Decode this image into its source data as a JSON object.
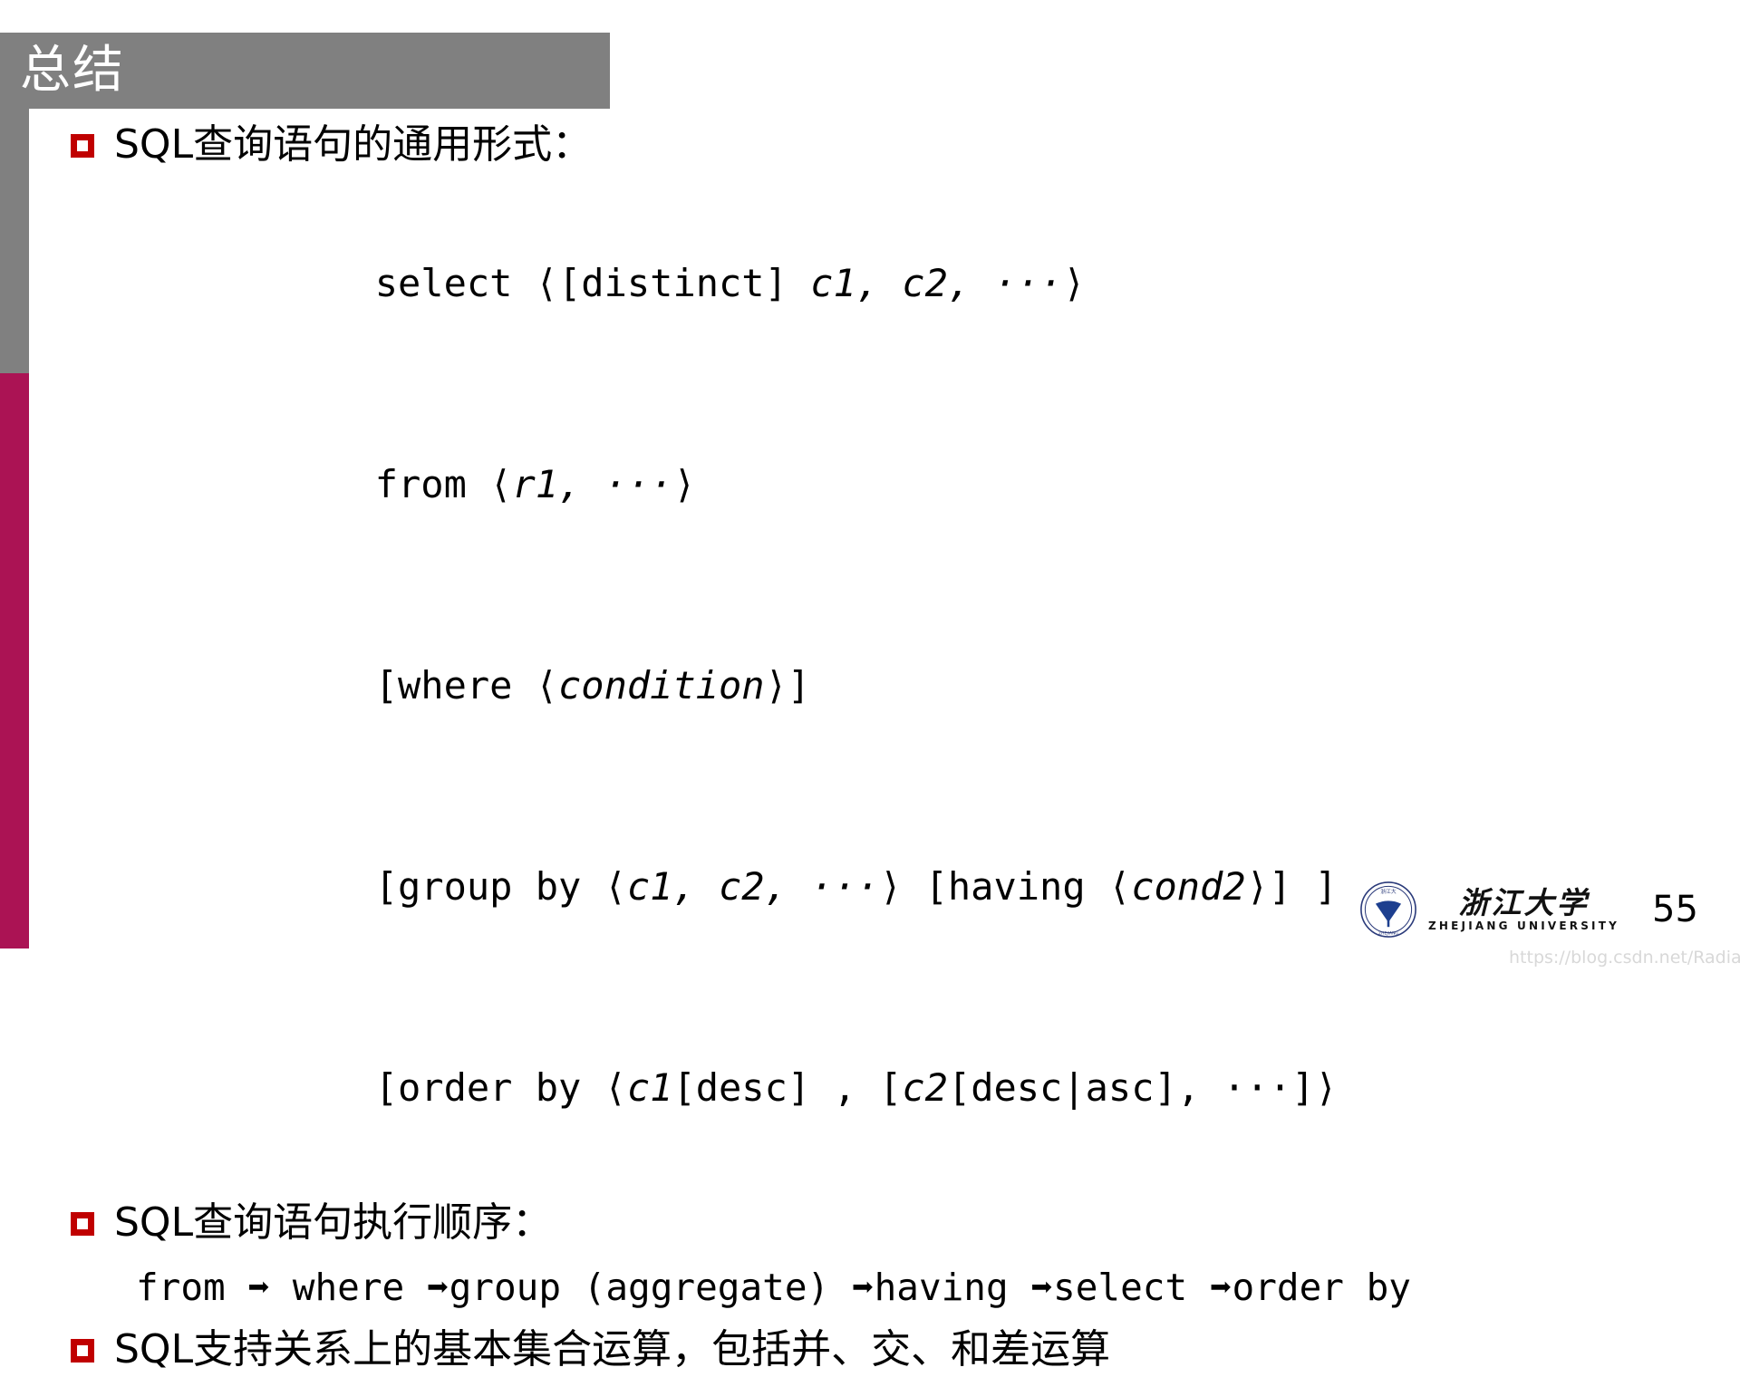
{
  "slide": {
    "title": "总结",
    "page_number": "55",
    "theme": {
      "title_bar_color": "#808080",
      "accent_bar_color": "#AB1354",
      "bullet_color": "#C00000",
      "text_color": "#000000",
      "background_color": "#FFFFFF"
    }
  },
  "bullets": [
    {
      "label": "SQL查询语句的通用形式："
    },
    {
      "label": "SQL查询语句执行顺序："
    },
    {
      "label": "SQL支持关系上的基本集合运算，包括并、交、和差运算"
    }
  ],
  "syntax_lines": [
    {
      "parts": [
        {
          "text": "select ⟨[distinct] ",
          "italic": false
        },
        {
          "text": "c1, c2, ···",
          "italic": true
        },
        {
          "text": "⟩",
          "italic": false
        }
      ]
    },
    {
      "parts": [
        {
          "text": "from ⟨",
          "italic": false
        },
        {
          "text": "r1, ···",
          "italic": true
        },
        {
          "text": "⟩",
          "italic": false
        }
      ]
    },
    {
      "parts": [
        {
          "text": "[where ⟨",
          "italic": false
        },
        {
          "text": "condition",
          "italic": true
        },
        {
          "text": "⟩]",
          "italic": false
        }
      ]
    },
    {
      "parts": [
        {
          "text": "[group by ⟨",
          "italic": false
        },
        {
          "text": "c1, c2, ···",
          "italic": true
        },
        {
          "text": "⟩ [having ⟨",
          "italic": false
        },
        {
          "text": "cond2",
          "italic": true
        },
        {
          "text": "⟩] ]",
          "italic": false
        }
      ]
    },
    {
      "parts": [
        {
          "text": "[order by ⟨",
          "italic": false
        },
        {
          "text": "c1",
          "italic": true
        },
        {
          "text": "[desc] , [",
          "italic": false
        },
        {
          "text": "c2",
          "italic": true
        },
        {
          "text": "[desc|asc], ···]⟩",
          "italic": false
        }
      ]
    }
  ],
  "execution_order": {
    "text": "from ➡ where ➡group (aggregate) ➡having ➡select ➡order by",
    "steps": [
      "from",
      "where",
      "group (aggregate)",
      "having",
      "select",
      "order by"
    ],
    "arrow_glyph": "➡"
  },
  "footer": {
    "logo_cn": "浙江大学",
    "logo_en": "ZHEJIANG UNIVERSITY",
    "seal_text": "ZHEJIANG UNIVERSITY",
    "watermark": "https://blog.csdn.net/RadiantJeral"
  }
}
